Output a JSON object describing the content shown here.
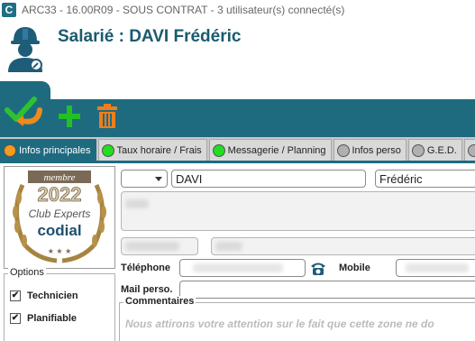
{
  "window": {
    "app_icon": "C",
    "title": "ARC33 - 16.00R09 - SOUS CONTRAT - 3 utilisateur(s) connecté(s)"
  },
  "header": {
    "title": "Salarié : DAVI Frédéric",
    "icon": "worker-helmet-icon"
  },
  "toolbar": {
    "buttons": [
      {
        "name": "validate-back",
        "icon": "check-arrow-icon",
        "color": "#2ec22e"
      },
      {
        "name": "add",
        "icon": "plus-icon",
        "color": "#22c022"
      },
      {
        "name": "delete",
        "icon": "trash-icon",
        "color": "#f07d1a"
      }
    ]
  },
  "tabs": [
    {
      "label": "Infos principales",
      "color": "#f59a1c",
      "active": true
    },
    {
      "label": "Taux horaire / Frais",
      "color": "#22dd22",
      "active": false
    },
    {
      "label": "Messagerie / Planning",
      "color": "#22dd22",
      "active": false
    },
    {
      "label": "Infos perso",
      "color": "#b0b0b0",
      "active": false
    },
    {
      "label": "G.E.D.",
      "color": "#b0b0b0",
      "active": false
    },
    {
      "label": "",
      "color": "#b0b0b0",
      "active": false
    }
  ],
  "logo": {
    "line1": "membre",
    "year": "2022",
    "line2": "Club Experts",
    "brand": "codial",
    "stars": "★ ★ ★"
  },
  "form": {
    "civility": "",
    "nom": "DAVI",
    "prenom": "Frédéric",
    "telephone_label": "Téléphone",
    "mobile_label": "Mobile",
    "mail_label": "Mail perso.",
    "comments_label": "Commentaires",
    "comments_text": "Nous attirons votre attention sur le fait que cette zone ne do"
  },
  "options": {
    "legend": "Options",
    "items": [
      {
        "label": "Technicien",
        "checked": true
      },
      {
        "label": "Planifiable",
        "checked": true
      }
    ]
  }
}
